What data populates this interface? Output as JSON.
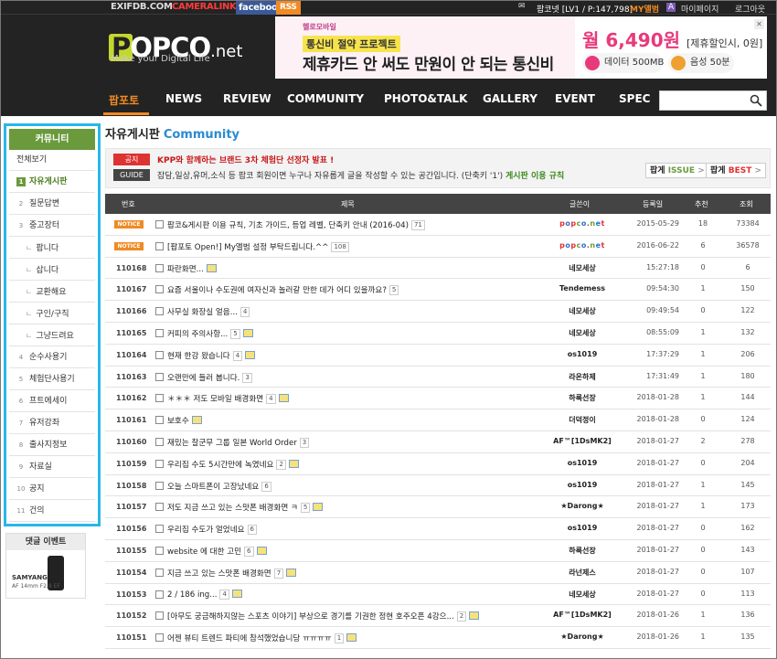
{
  "topbar": {
    "links": [
      "EXIFDB.COM",
      "CAMERALINK",
      "facebook",
      "RSS"
    ],
    "user_info": "팝코넷 [LV1 / P:147,798]",
    "myalbum": "MY앨범",
    "mypage": "마이페이지",
    "logout": "로그아웃"
  },
  "logo": {
    "text": "OPCO",
    "first": "P",
    "suffix": ".net",
    "tagline": "Make your Digital Life"
  },
  "ad": {
    "brand": "헬로모바일",
    "promo": "통신비 절약 프로젝트",
    "headline": "제휴카드 안 써도 만원이 안 되는 통신비",
    "price": "월 6,490원",
    "price_note": "[제휴할인시, 0원]",
    "data_pill": "데이터 500MB",
    "voice_pill": "음성 50분"
  },
  "nav": {
    "items": [
      "팝포토",
      "NEWS",
      "REVIEW",
      "COMMUNITY",
      "PHOTO&TALK",
      "GALLERY",
      "EVENT",
      "SPEC"
    ],
    "search_placeholder": ""
  },
  "sidebar": {
    "header": "커뮤니티",
    "items": [
      {
        "num": "",
        "label": "전체보기"
      },
      {
        "num": "1",
        "label": "자유게시판"
      },
      {
        "num": "2",
        "label": "질문답변"
      },
      {
        "num": "3",
        "label": "중고장터"
      },
      {
        "num": "",
        "label": "팝니다"
      },
      {
        "num": "",
        "label": "삽니다"
      },
      {
        "num": "",
        "label": "교환해요"
      },
      {
        "num": "",
        "label": "구인/구직"
      },
      {
        "num": "",
        "label": "그냥드려요"
      },
      {
        "num": "4",
        "label": "순수사용기"
      },
      {
        "num": "5",
        "label": "체험단사용기"
      },
      {
        "num": "6",
        "label": "프트에세이"
      },
      {
        "num": "7",
        "label": "유저강좌"
      },
      {
        "num": "8",
        "label": "출사지정보"
      },
      {
        "num": "9",
        "label": "자료실"
      },
      {
        "num": "10",
        "label": "공지"
      },
      {
        "num": "11",
        "label": "건의"
      }
    ],
    "event_title": "댓글 이벤트",
    "event_brand": "SAMYANG",
    "event_model": "AF 14mm F2.8 EF"
  },
  "board": {
    "title": "자유게시판",
    "title_en": "Community",
    "notice_tag": "공지",
    "notice_text": "KPP와 함께하는 브랜드 3차 체험단 선정자 발표 !",
    "guide_tag": "GUIDE",
    "guide_text": "잡담,일상,유머,소식 등 팝코 회원이면 누구나 자유롭게 글을 작성할 수 있는 공간입니다. (단축키 '1')",
    "guide_link": "게시판 이용 규칙",
    "btn_issue_prefix": "팝게",
    "btn_issue": "ISSUE",
    "btn_best_prefix": "팝게",
    "btn_best": "BEST",
    "columns": [
      "번호",
      "제목",
      "글쓴이",
      "등록일",
      "추천",
      "조회"
    ]
  },
  "posts": [
    {
      "num": "NOTICE",
      "title": "팝코&게시판 이용 규칙, 기초 가이드, 등업 레벨, 단축키 안내 (2016-04)",
      "comments": "71",
      "img": false,
      "writer": "popco.net",
      "date": "2015-05-29",
      "rec": "18",
      "views": "73384"
    },
    {
      "num": "NOTICE",
      "title": "[팝포토 Open!] My앨범 설정 부탁드립니다.^^",
      "comments": "108",
      "img": false,
      "writer": "popco.net",
      "date": "2016-06-22",
      "rec": "6",
      "views": "36578"
    },
    {
      "num": "110168",
      "title": "파란화면...",
      "comments": "",
      "img": true,
      "writer": "네모세상",
      "date": "15:27:18",
      "rec": "0",
      "views": "6"
    },
    {
      "num": "110167",
      "title": "요즘 서울이나 수도권에 여자신과 놀러갈 만한 데가 어디 있을까요?",
      "comments": "5",
      "img": false,
      "writer": "Tendemess",
      "date": "09:54:30",
      "rec": "1",
      "views": "150"
    },
    {
      "num": "110166",
      "title": "사무실 화장실 얼음...",
      "comments": "4",
      "img": false,
      "writer": "네모세상",
      "date": "09:49:54",
      "rec": "0",
      "views": "122"
    },
    {
      "num": "110165",
      "title": "커피의 주의사항...",
      "comments": "5",
      "img": true,
      "writer": "네모세상",
      "date": "08:55:09",
      "rec": "1",
      "views": "132"
    },
    {
      "num": "110164",
      "title": "현재 한강 왔습니다",
      "comments": "4",
      "img": true,
      "writer": "os1019",
      "date": "17:37:29",
      "rec": "1",
      "views": "206"
    },
    {
      "num": "110163",
      "title": "오랜만에 들러 봅니다.",
      "comments": "3",
      "img": false,
      "writer": "라온하제",
      "date": "17:31:49",
      "rec": "1",
      "views": "180"
    },
    {
      "num": "110162",
      "title": "＊＊＊ 저도 모바일 배경화면",
      "comments": "4",
      "img": true,
      "writer": "하룩선장",
      "date": "2018-01-28",
      "rec": "1",
      "views": "144"
    },
    {
      "num": "110161",
      "title": "보호수",
      "comments": "",
      "img": true,
      "writer": "더덕정이",
      "date": "2018-01-28",
      "rec": "0",
      "views": "124"
    },
    {
      "num": "110160",
      "title": "재밌는 찰군무 그룹 일본 World Order",
      "comments": "3",
      "img": false,
      "writer": "AF™[1DsMK2]",
      "date": "2018-01-27",
      "rec": "2",
      "views": "278"
    },
    {
      "num": "110159",
      "title": "우리집 수도 5시간만에 녹였네요",
      "comments": "2",
      "img": true,
      "writer": "os1019",
      "date": "2018-01-27",
      "rec": "0",
      "views": "204"
    },
    {
      "num": "110158",
      "title": "오늘 스마트폰이 고장났네요",
      "comments": "6",
      "img": false,
      "writer": "os1019",
      "date": "2018-01-27",
      "rec": "1",
      "views": "145"
    },
    {
      "num": "110157",
      "title": "저도 지금 쓰고 있는 스맛폰 배경화면 ㅋ",
      "comments": "5",
      "img": true,
      "writer": "★Darong★",
      "date": "2018-01-27",
      "rec": "1",
      "views": "173"
    },
    {
      "num": "110156",
      "title": "우리집 수도가 얼었네요",
      "comments": "6",
      "img": false,
      "writer": "os1019",
      "date": "2018-01-27",
      "rec": "0",
      "views": "162"
    },
    {
      "num": "110155",
      "title": "website 에 대한 고민",
      "comments": "6",
      "img": true,
      "writer": "하룩선장",
      "date": "2018-01-27",
      "rec": "0",
      "views": "143"
    },
    {
      "num": "110154",
      "title": "지금 쓰고 있는 스맛폰 배경화면",
      "comments": "7",
      "img": true,
      "writer": "라넌제스",
      "date": "2018-01-27",
      "rec": "0",
      "views": "107"
    },
    {
      "num": "110153",
      "title": "2 / 186 ing...",
      "comments": "4",
      "img": true,
      "writer": "네모세상",
      "date": "2018-01-27",
      "rec": "0",
      "views": "113"
    },
    {
      "num": "110152",
      "title": "[아무도 궁금해하지않는 스포츠 이야기] 부상으로 경기를 기권한 정현 호주오픈 4강으...",
      "comments": "2",
      "img": true,
      "writer": "AF™[1DsMK2]",
      "date": "2018-01-26",
      "rec": "1",
      "views": "136"
    },
    {
      "num": "110151",
      "title": "어젠 뷰티 트렌드 파티에 참석했었습니당 ㅠㅠㅠㅠ",
      "comments": "1",
      "img": true,
      "writer": "★Darong★",
      "date": "2018-01-26",
      "rec": "1",
      "views": "135"
    }
  ]
}
